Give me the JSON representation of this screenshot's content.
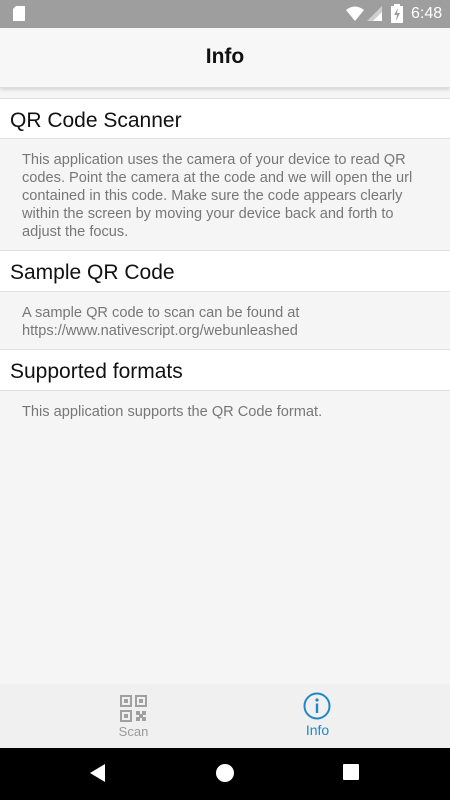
{
  "status_bar": {
    "time": "6:48"
  },
  "action_bar": {
    "title": "Info"
  },
  "sections": [
    {
      "title": "QR Code Scanner",
      "body": "This application uses the camera of your device to read QR codes. Point the camera at the code and we will open the url contained in this code. Make sure the code appears clearly within the screen by moving your device back and forth to adjust the focus."
    },
    {
      "title": "Sample QR Code",
      "body": "A sample QR code to scan can be found at https://www.nativescript.org/webunleashed"
    },
    {
      "title": "Supported formats",
      "body": "This application supports the QR Code format."
    }
  ],
  "tabs": [
    {
      "label": "Scan",
      "icon": "qr-code-icon",
      "selected": false
    },
    {
      "label": "Info",
      "icon": "info-icon",
      "selected": true
    }
  ],
  "colors": {
    "accent": "#1e88c8",
    "status_bar": "#9e9e9e",
    "inactive_tab": "#9a9a9a"
  }
}
